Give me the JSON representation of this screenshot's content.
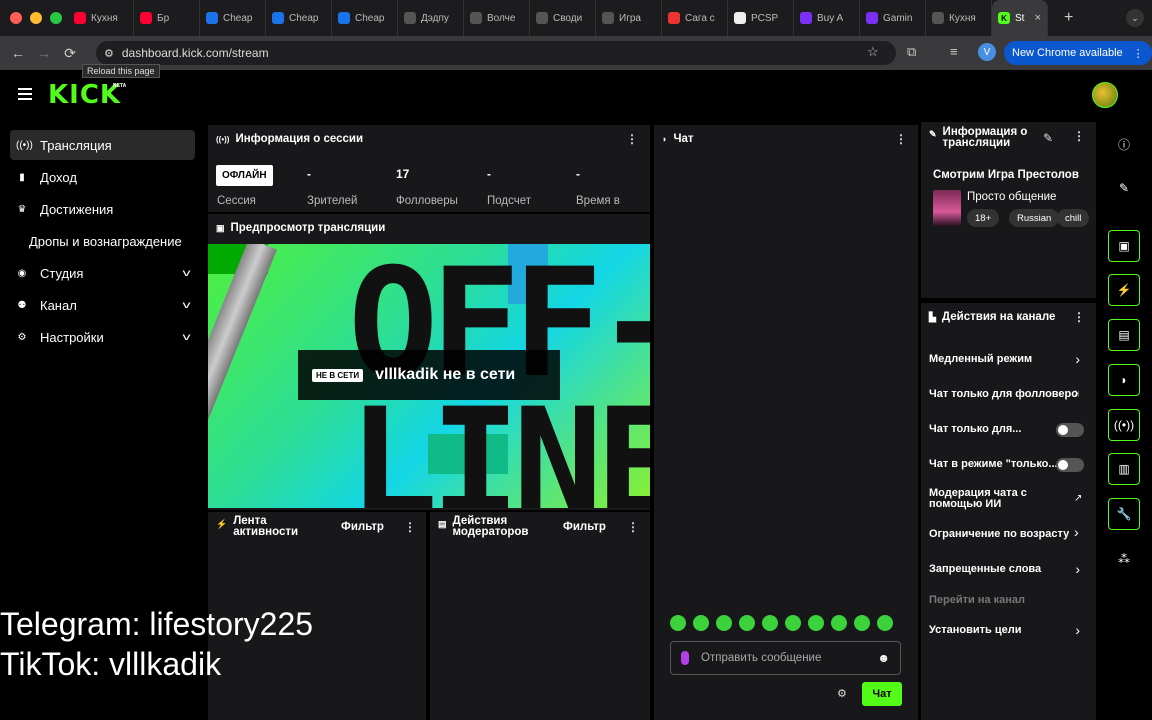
{
  "tabs": [
    {
      "label": "Кухня",
      "color": "#ff0033",
      "icon": "youtube-icon"
    },
    {
      "label": "Бр",
      "color": "#ff0033",
      "icon": "youtube-icon"
    },
    {
      "label": "Cheap",
      "color": "#1a73e8",
      "icon": "app-icon"
    },
    {
      "label": "Cheap",
      "color": "#1a73e8",
      "icon": "t-icon"
    },
    {
      "label": "Cheap",
      "color": "#1a73e8",
      "icon": "app-icon"
    },
    {
      "label": "Дэдпу",
      "color": "#555",
      "icon": "hat-icon"
    },
    {
      "label": "Волче",
      "color": "#555",
      "icon": "hat-icon"
    },
    {
      "label": "Своди",
      "color": "#555",
      "icon": "hat-icon"
    },
    {
      "label": "Игра",
      "color": "#555",
      "icon": "hat-icon"
    },
    {
      "label": "Сага с",
      "color": "#e33",
      "icon": "globe-icon"
    },
    {
      "label": "PCSP",
      "color": "#eee",
      "icon": "disc-icon"
    },
    {
      "label": "Buy A",
      "color": "#7b2ff7",
      "icon": "c-icon"
    },
    {
      "label": "Gamin",
      "color": "#7b2ff7",
      "icon": "c-icon"
    },
    {
      "label": "Кухня",
      "color": "#555",
      "icon": "hat-icon"
    }
  ],
  "active_tab": {
    "label": "St",
    "close": "×"
  },
  "newtab": "+",
  "url": "dashboard.kick.com/stream",
  "tooltip": "Reload this page",
  "chrome_update": "New Chrome available",
  "profile_letter": "V",
  "logo": "KICK",
  "logo_beta": "BETA",
  "sidebar": {
    "items": [
      {
        "label": "Трансляция",
        "icon": "broadcast-icon"
      },
      {
        "label": "Доход",
        "icon": "chart-icon"
      },
      {
        "label": "Достижения",
        "icon": "trophy-icon"
      },
      {
        "label": "Дропы и вознаграждение",
        "icon": ""
      },
      {
        "label": "Студия",
        "icon": "studio-icon"
      },
      {
        "label": "Канал",
        "icon": "channel-icon"
      },
      {
        "label": "Настройки",
        "icon": "gear-icon"
      }
    ]
  },
  "overlay": {
    "line1": "Telegram: lifestory225",
    "line2": "TikTok: vlllkadik"
  },
  "session": {
    "title": "Информация о сессии",
    "status": "ОФЛАЙН",
    "status_label": "Сессия",
    "stats": [
      {
        "value": "-",
        "label": "Зрителей"
      },
      {
        "value": "17",
        "label": "Фолловеры"
      },
      {
        "value": "-",
        "label": "Подсчет"
      },
      {
        "value": "-",
        "label": "Время в"
      }
    ]
  },
  "preview": {
    "title": "Предпросмотр трансляции",
    "badge": "НЕ В СЕТИ",
    "message": "vlllkadik не в сети",
    "art_text": "OFF-LINE"
  },
  "activity": {
    "title": "Лента активности",
    "filter": "Фильтр"
  },
  "modactions": {
    "title": "Действия модераторов",
    "filter": "Фильтр"
  },
  "chat": {
    "title": "Чат",
    "placeholder": "Отправить сообщение",
    "send": "Чат"
  },
  "stream_info": {
    "title": "Информация о трансляции",
    "stream_title": "Смотрим Игра Престолов",
    "category": "Просто общение",
    "tags": [
      "18+",
      "Russian",
      "chill"
    ]
  },
  "channel_actions": {
    "title": "Действия на канале",
    "items": [
      {
        "label": "Медленный режим",
        "control": "arrow"
      },
      {
        "label": "Чат только для фолловеров",
        "control": "arrow"
      },
      {
        "label": "Чат только для...",
        "control": "toggle"
      },
      {
        "label": "Чат в режиме \"только...",
        "control": "toggle"
      },
      {
        "label": "Модерация чата с помощью ИИ",
        "control": "external"
      },
      {
        "label": "Ограничение по возрасту",
        "control": "arrow"
      },
      {
        "label": "Запрещенные слова",
        "control": "arrow"
      },
      {
        "label": "Перейти на канал",
        "control": "none"
      },
      {
        "label": "Установить цели",
        "control": "arrow"
      }
    ]
  },
  "accent": "#53fc18"
}
